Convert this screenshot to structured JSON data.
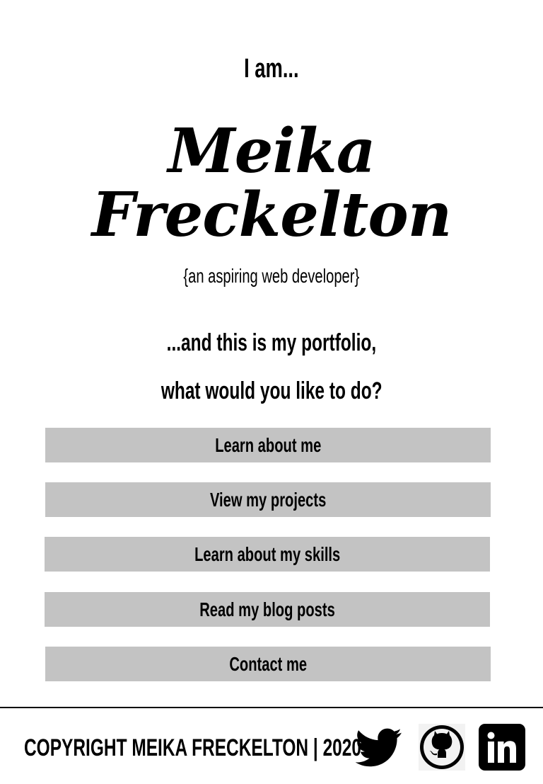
{
  "hero": {
    "intro": "I am...",
    "first_name": "Meika",
    "last_name": "Freckelton",
    "tagline": "{an aspiring web developer}",
    "prompt_line1": "...and this is my portfolio,",
    "prompt_line2": "what would you like to do?"
  },
  "nav": {
    "buttons": [
      {
        "label": "Learn about me"
      },
      {
        "label": "View my projects"
      },
      {
        "label": "Learn about my skills"
      },
      {
        "label": "Read my blog posts"
      },
      {
        "label": "Contact me"
      }
    ]
  },
  "footer": {
    "copyright": "COPYRIGHT MEIKA FRECKELTON | 2020",
    "social": [
      {
        "icon": "twitter-icon"
      },
      {
        "icon": "github-icon"
      },
      {
        "icon": "linkedin-icon"
      }
    ]
  },
  "colors": {
    "background": "#ffffff",
    "text": "#000000",
    "button_bg": "#c3c3c3"
  }
}
